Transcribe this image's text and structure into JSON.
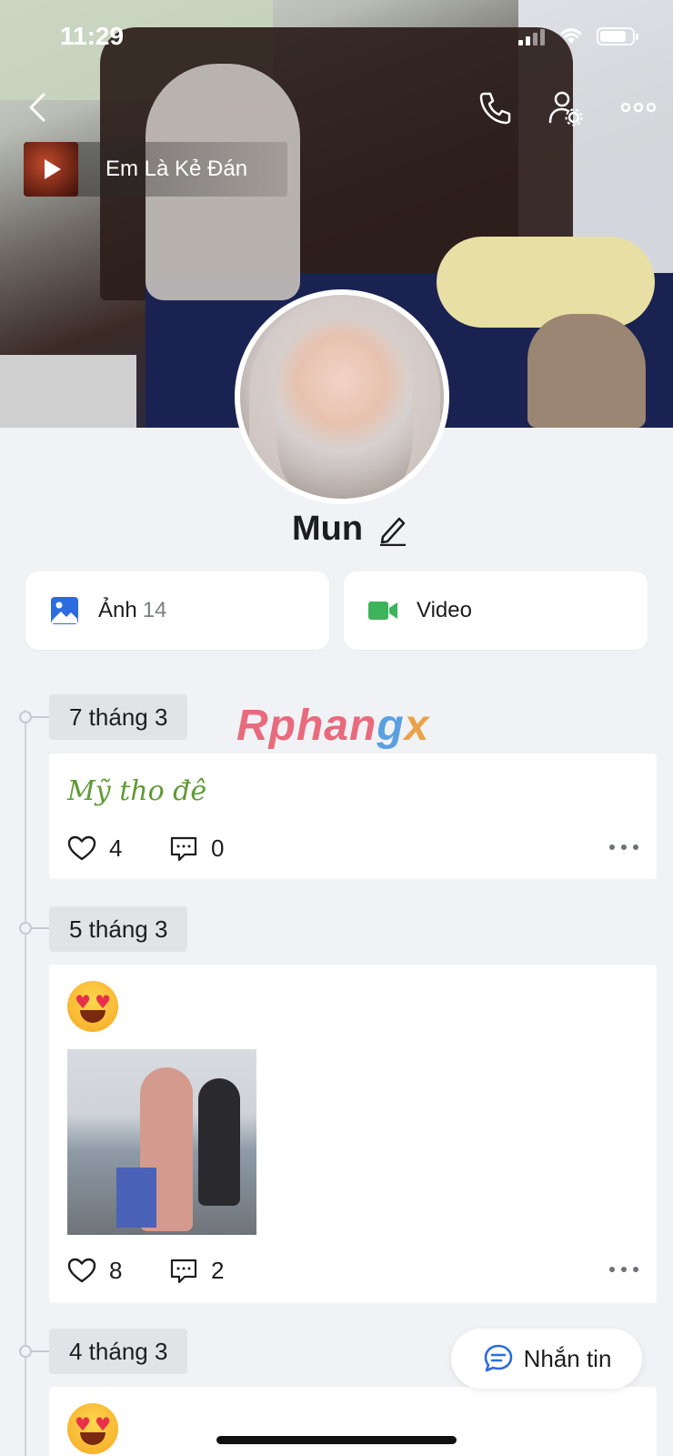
{
  "status_bar": {
    "time": "11:29"
  },
  "header": {
    "music_title": "Em Là Kẻ Đán"
  },
  "profile": {
    "name": "Mun"
  },
  "media_cards": [
    {
      "label": "Ảnh",
      "count": "14"
    },
    {
      "label": "Video",
      "count": ""
    }
  ],
  "watermark": {
    "part1": "Rphan",
    "part2": "g",
    "part3": "x"
  },
  "posts": [
    {
      "date": "7 tháng 3",
      "text": "Mỹ tho đê",
      "likes": "4",
      "comments": "0"
    },
    {
      "date": "5 tháng 3",
      "likes": "8",
      "comments": "2"
    },
    {
      "date": "4 tháng 3"
    }
  ],
  "message_button": {
    "label": "Nhắn tin"
  },
  "colors": {
    "accent_blue": "#2d6ce0",
    "video_green": "#3cb55a",
    "post_text_green": "#5f9b34"
  }
}
